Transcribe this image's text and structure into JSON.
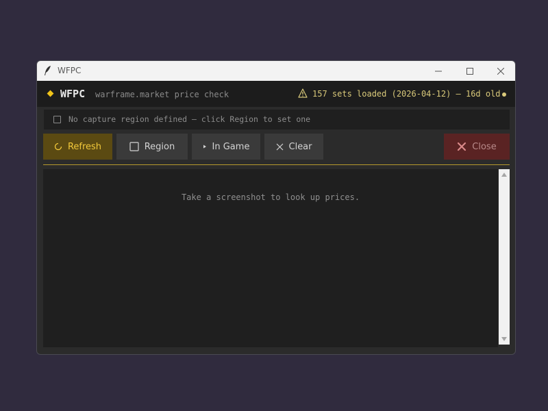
{
  "window": {
    "title": "WFPC"
  },
  "header": {
    "brand": "WFPC",
    "subtitle": "warframe.market price check",
    "status": "157 sets loaded (2026-04-12) — 16d old",
    "status_color": "#d9c97a",
    "accent_color": "#f0c419"
  },
  "region": {
    "checked": false,
    "message": "No capture region defined — click Region to set one"
  },
  "toolbar": {
    "refresh_label": "Refresh",
    "region_label": "Region",
    "ingame_label": "In Game",
    "clear_label": "Clear",
    "close_label": "Close"
  },
  "results": {
    "placeholder": "Take a screenshot to look up prices."
  }
}
